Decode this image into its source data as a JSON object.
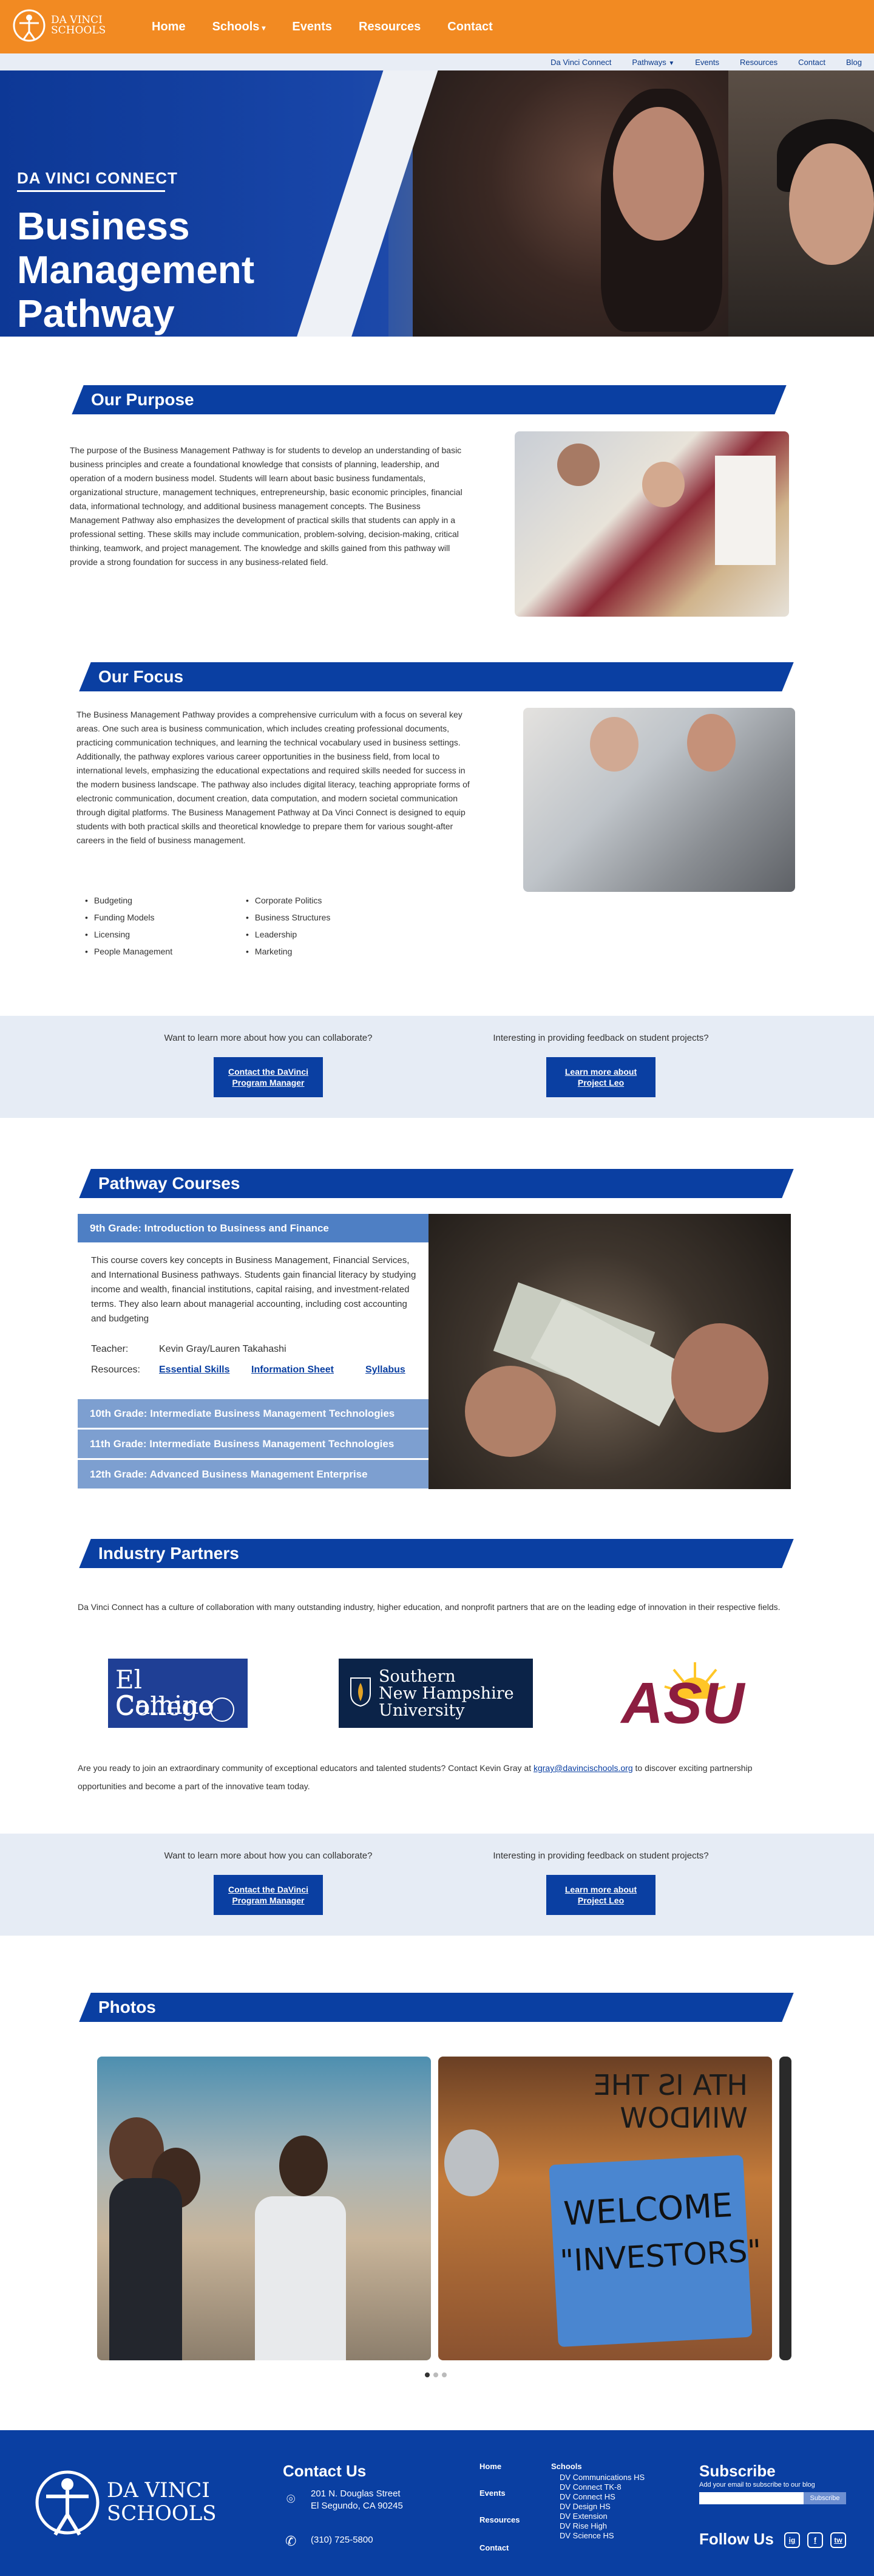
{
  "brand": {
    "logo_text_line1": "DA VINCI",
    "logo_text_line2": "SCHOOLS",
    "primary": "#0a3fa2",
    "accent": "#f28a22"
  },
  "main_nav": [
    "Home",
    "Schools",
    "Events",
    "Resources",
    "Contact"
  ],
  "sub_nav": [
    "Da Vinci Connect",
    "Pathways",
    "Events",
    "Resources",
    "Contact",
    "Blog"
  ],
  "hero": {
    "kicker": "DA VINCI CONNECT",
    "title_line1": "Business",
    "title_line2": "Management",
    "title_line3": "Pathway"
  },
  "purpose": {
    "heading": "Our Purpose",
    "text": "The purpose of the Business Management Pathway is for students to develop an understanding of basic business principles and create a foundational knowledge that consists of planning, leadership, and operation of a modern business model. Students will learn about basic business fundamentals, organizational structure, management techniques, entrepreneurship, basic economic principles, financial data, informational technology, and additional business management concepts. The Business Management Pathway also emphasizes the development of practical skills that students can apply in a professional setting. These skills may include communication, problem-solving, decision-making, critical thinking, teamwork, and project management. The knowledge and skills gained from this pathway will provide a strong foundation for success in any business-related field."
  },
  "focus": {
    "heading": "Our Focus",
    "text": "The Business Management Pathway provides a comprehensive curriculum with a focus on several key areas. One such area is business communication, which includes creating professional documents, practicing communication techniques, and learning the technical vocabulary used in business settings. Additionally, the pathway explores various career opportunities in the business field, from local to international levels, emphasizing the educational expectations and required skills needed for success in the modern business landscape. The pathway also includes digital literacy, teaching appropriate forms of electronic communication, document creation, data computation, and modern societal communication through digital platforms. The Business Management Pathway at Da Vinci Connect is designed to equip students with both practical skills and theoretical knowledge to prepare them for various sought-after careers in the field of business management.",
    "bullets_left": [
      "Budgeting",
      "Funding Models",
      "Licensing",
      "People Management"
    ],
    "bullets_right": [
      "Corporate Politics",
      "Business Structures",
      "Leadership",
      "Marketing"
    ]
  },
  "cta": {
    "q1": "Want to learn more about how you can collaborate?",
    "b1": "Contact the DaVinci Program Manager",
    "q2": "Interesting in providing feedback on student projects?",
    "b2": "Learn more about Project Leo"
  },
  "courses": {
    "heading": "Pathway Courses",
    "open_title": "9th Grade: Introduction to Business and Finance",
    "open_text": "This course covers key concepts in Business Management, Financial Services, and International Business pathways. Students gain financial literacy by studying income and wealth, financial institutions, capital raising, and investment-related terms. They also learn about managerial accounting, including cost accounting and budgeting",
    "teacher_label": "Teacher:",
    "teacher": "Kevin Gray/Lauren Takahashi",
    "resources_label": "Resources:",
    "links": [
      "Essential Skills",
      "Information Sheet",
      "Syllabus"
    ],
    "others": [
      "10th Grade: Intermediate Business Management Technologies",
      "11th Grade: Intermediate Business Management Technologies",
      "12th Grade: Advanced Business Management Enterprise"
    ]
  },
  "partners": {
    "heading": "Industry Partners",
    "intro": "Da Vinci Connect has a culture of collaboration with many outstanding industry, higher education, and nonprofit partners that are on the leading edge of innovation in their respective fields.",
    "logo1_line1": "El Camino",
    "logo1_line2": "College",
    "logo2_line1": "Southern",
    "logo2_line2": "New Hampshire",
    "logo2_line3": "University",
    "logo3": "ASU",
    "outro_pre": "Are you ready to join an extraordinary community of exceptional educators and talented students? Contact Kevin Gray at",
    "email": "kgray@davincischools.org",
    "outro_post": "to discover exciting partnership opportunities and become a part of the innovative team today."
  },
  "photos": {
    "heading": "Photos",
    "sign_line1": "WELCOME",
    "sign_line2": "\"INVESTORS\"",
    "window_text": "HTA IS THE WINDOW"
  },
  "footer": {
    "logo_line1": "DA VINCI",
    "logo_line2": "SCHOOLS",
    "contact_title": "Contact Us",
    "address1": "201 N. Douglas Street",
    "address2": "El Segundo, CA 90245",
    "phone": "(310) 725-5800",
    "nav": [
      "Home",
      "Events",
      "Resources",
      "Contact"
    ],
    "schools_title": "Schools",
    "schools": [
      "DV Communications HS",
      "DV Connect TK-8",
      "DV Connect HS",
      "DV Design HS",
      "DV Extension",
      "DV Rise High",
      "DV Science HS"
    ],
    "subscribe_title": "Subscribe",
    "subscribe_sub": "Add your email to subscribe to our blog",
    "subscribe_btn": "Subscribe",
    "follow": "Follow Us",
    "social": [
      "ig",
      "f",
      "tw"
    ]
  }
}
